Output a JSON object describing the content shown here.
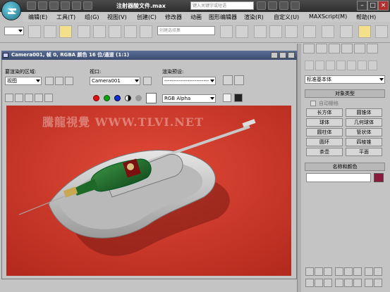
{
  "app": {
    "window_title": "注射器酸文件.max",
    "search_placeholder": "键入关键字或短语"
  },
  "menubar": {
    "items": [
      "编辑(E)",
      "工具(T)",
      "组(G)",
      "视图(V)",
      "创建(C)",
      "修改器",
      "动画",
      "图形编辑器",
      "渲染(R)",
      "自定义(U)",
      "MAXScript(M)",
      "帮助(H)"
    ]
  },
  "toolbar": {
    "view_dropdown": "",
    "selection_set_placeholder": "创建选择集"
  },
  "render_window": {
    "title": "Camera001, 帧 0, RGBA 颜色 16 位/通道 (1:1)",
    "area_label": "要渲染的区域:",
    "area_value": "视图",
    "viewport_label": "视口:",
    "viewport_value": "Camera001",
    "preset_label": "渲染预设:",
    "preset_value": "-------------------------",
    "channel_value": "RGB Alpha"
  },
  "watermark": "騰龍視覺 WWW.TLVI.NET",
  "command_panel": {
    "category_dropdown": "标准基本体",
    "object_type_header": "对象类型",
    "autogrid_label": "自动栅格",
    "object_buttons": [
      "长方体",
      "圆锥体",
      "球体",
      "几何球体",
      "圆柱体",
      "管状体",
      "圆环",
      "四棱锥",
      "茶壶",
      "平面"
    ],
    "name_color_header": "名称和颜色"
  },
  "colors": {
    "viewport_bg": "#d23a2a",
    "object_color": "#8c1a3a"
  }
}
